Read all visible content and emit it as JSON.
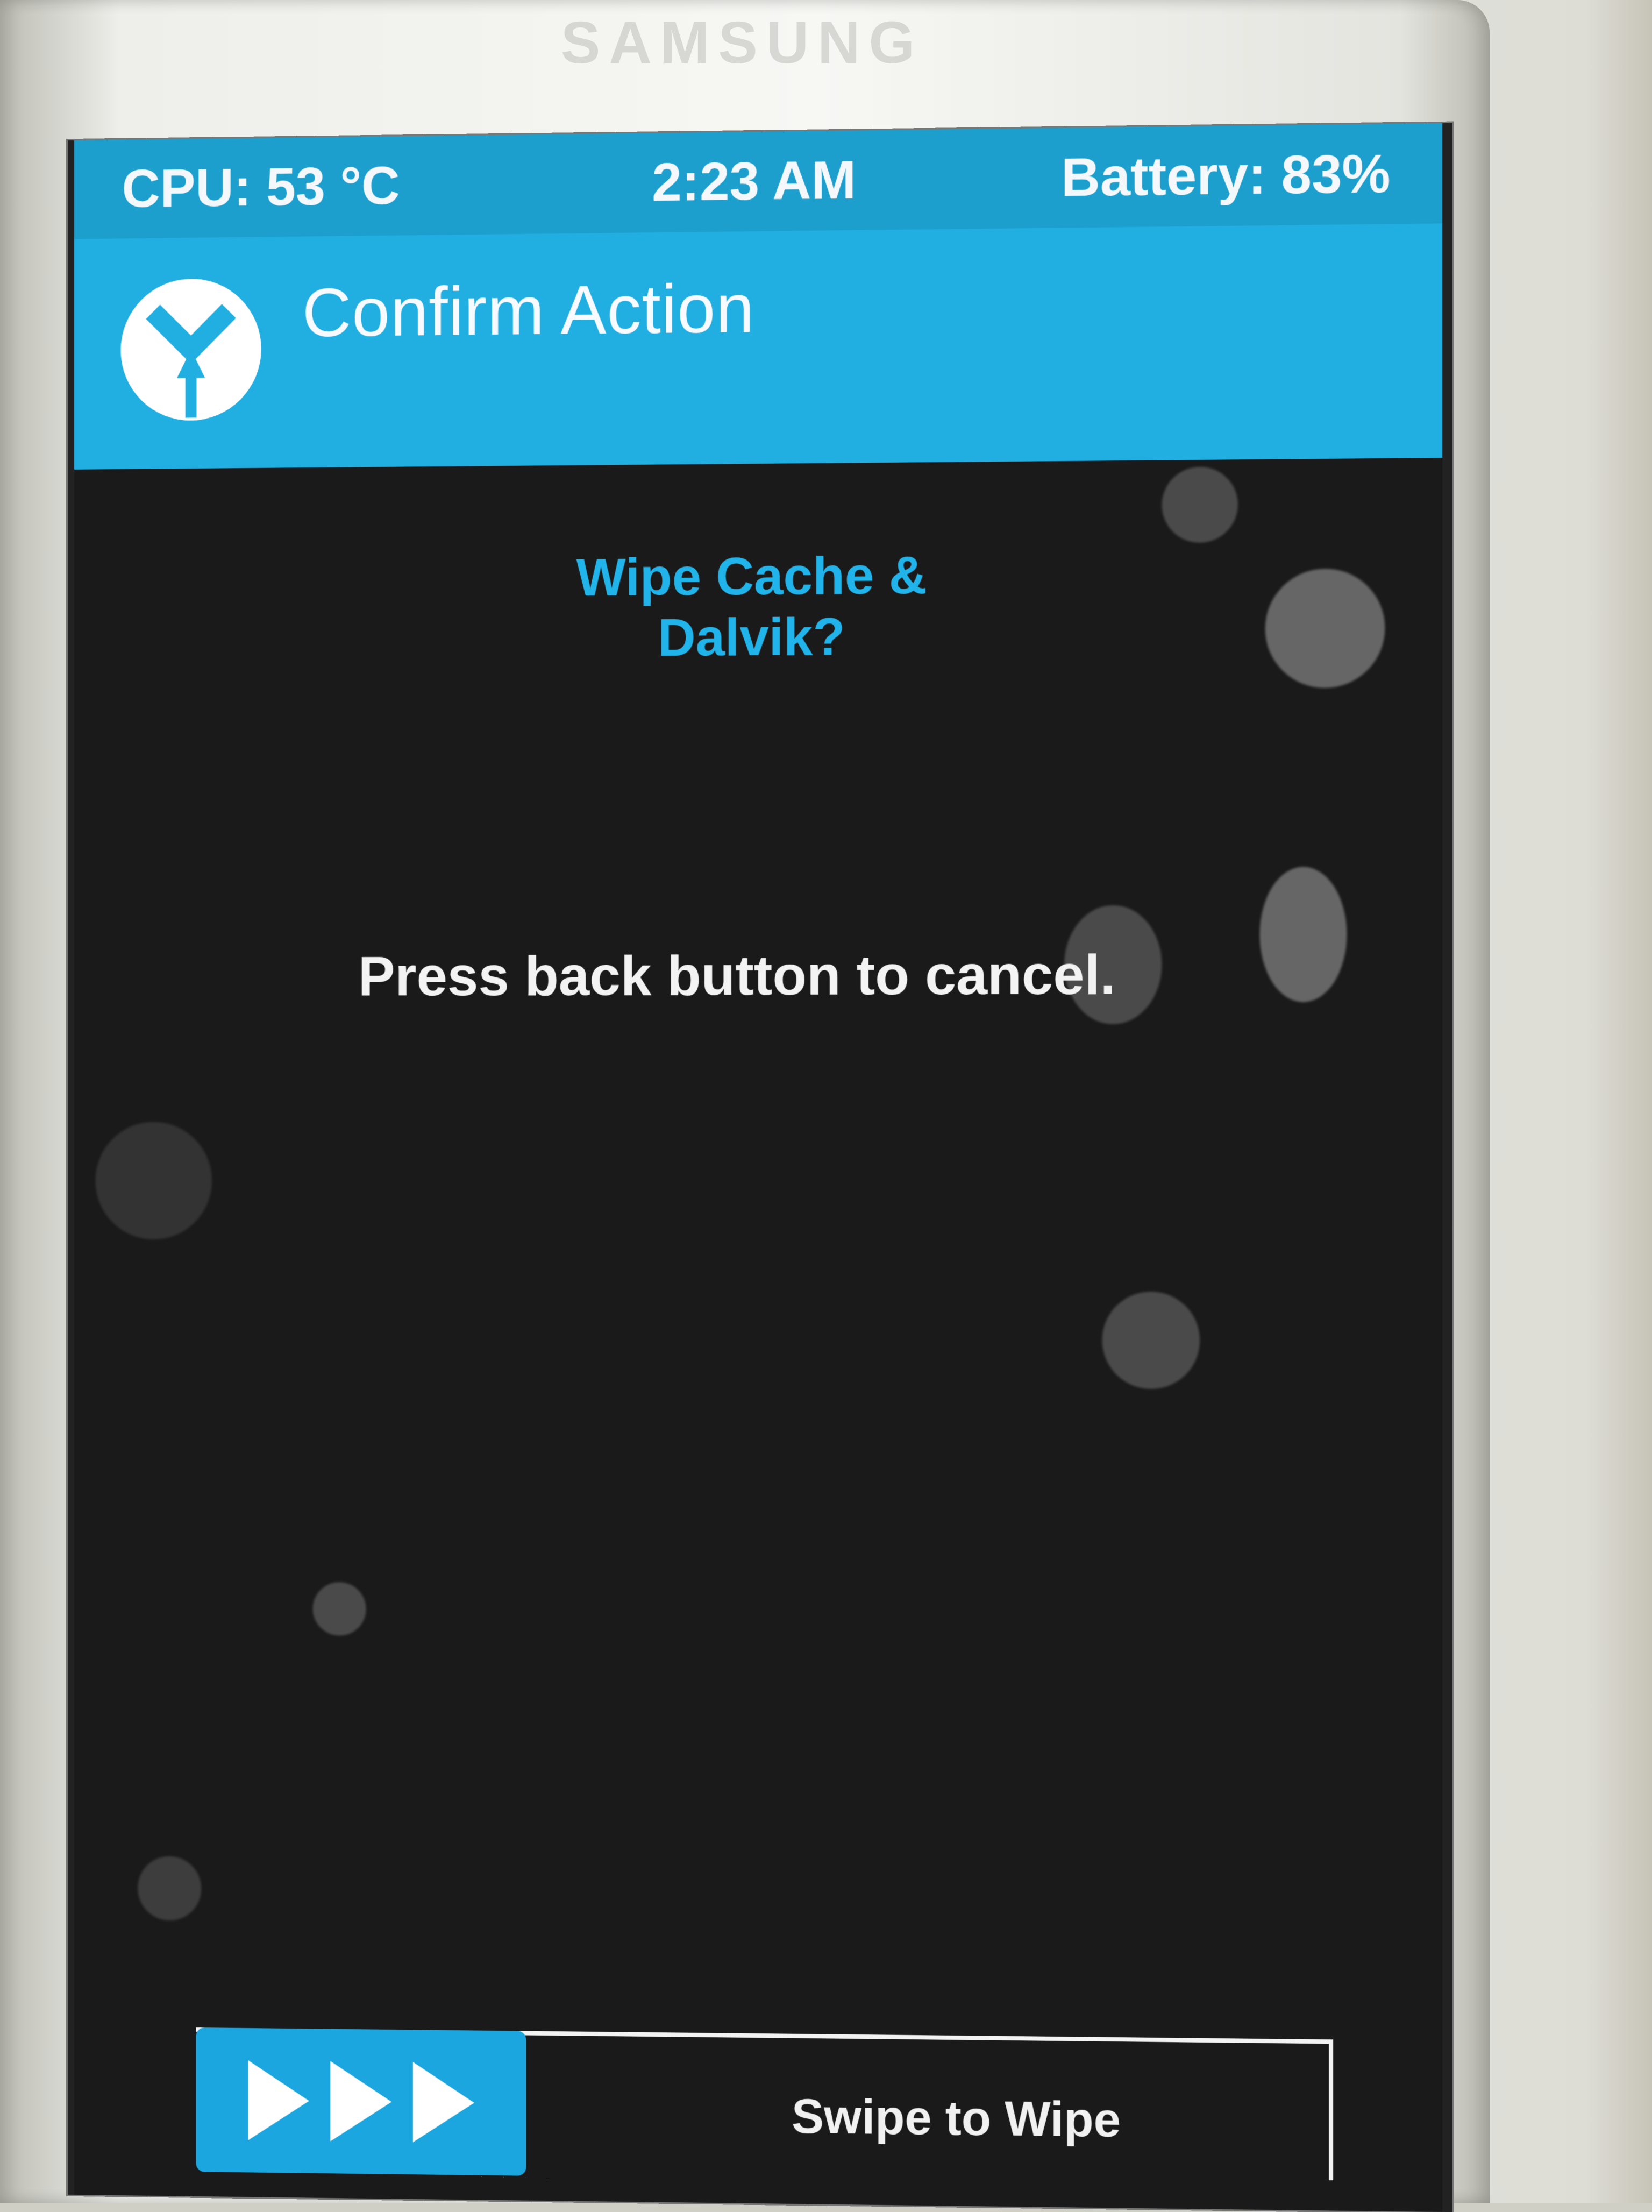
{
  "device": {
    "brand": "SAMSUNG"
  },
  "status_bar": {
    "cpu": "CPU: 53 °C",
    "time": "2:23 AM",
    "battery": "Battery: 83%"
  },
  "header": {
    "title": "Confirm Action",
    "logo_icon": "teamwin-logo-icon"
  },
  "content": {
    "prompt_title": "Wipe Cache & Dalvik?",
    "message": "Press back button to cancel."
  },
  "swipe": {
    "label": "Swipe to Wipe",
    "icons": [
      "arrow-right-icon",
      "arrow-right-icon",
      "arrow-right-icon"
    ]
  },
  "colors": {
    "accent": "#21aee1",
    "accent_dark": "#1d9fce",
    "screen_bg": "#1b1a1a",
    "text_light": "#f3f3f3",
    "title_blue": "#21b4ea"
  }
}
